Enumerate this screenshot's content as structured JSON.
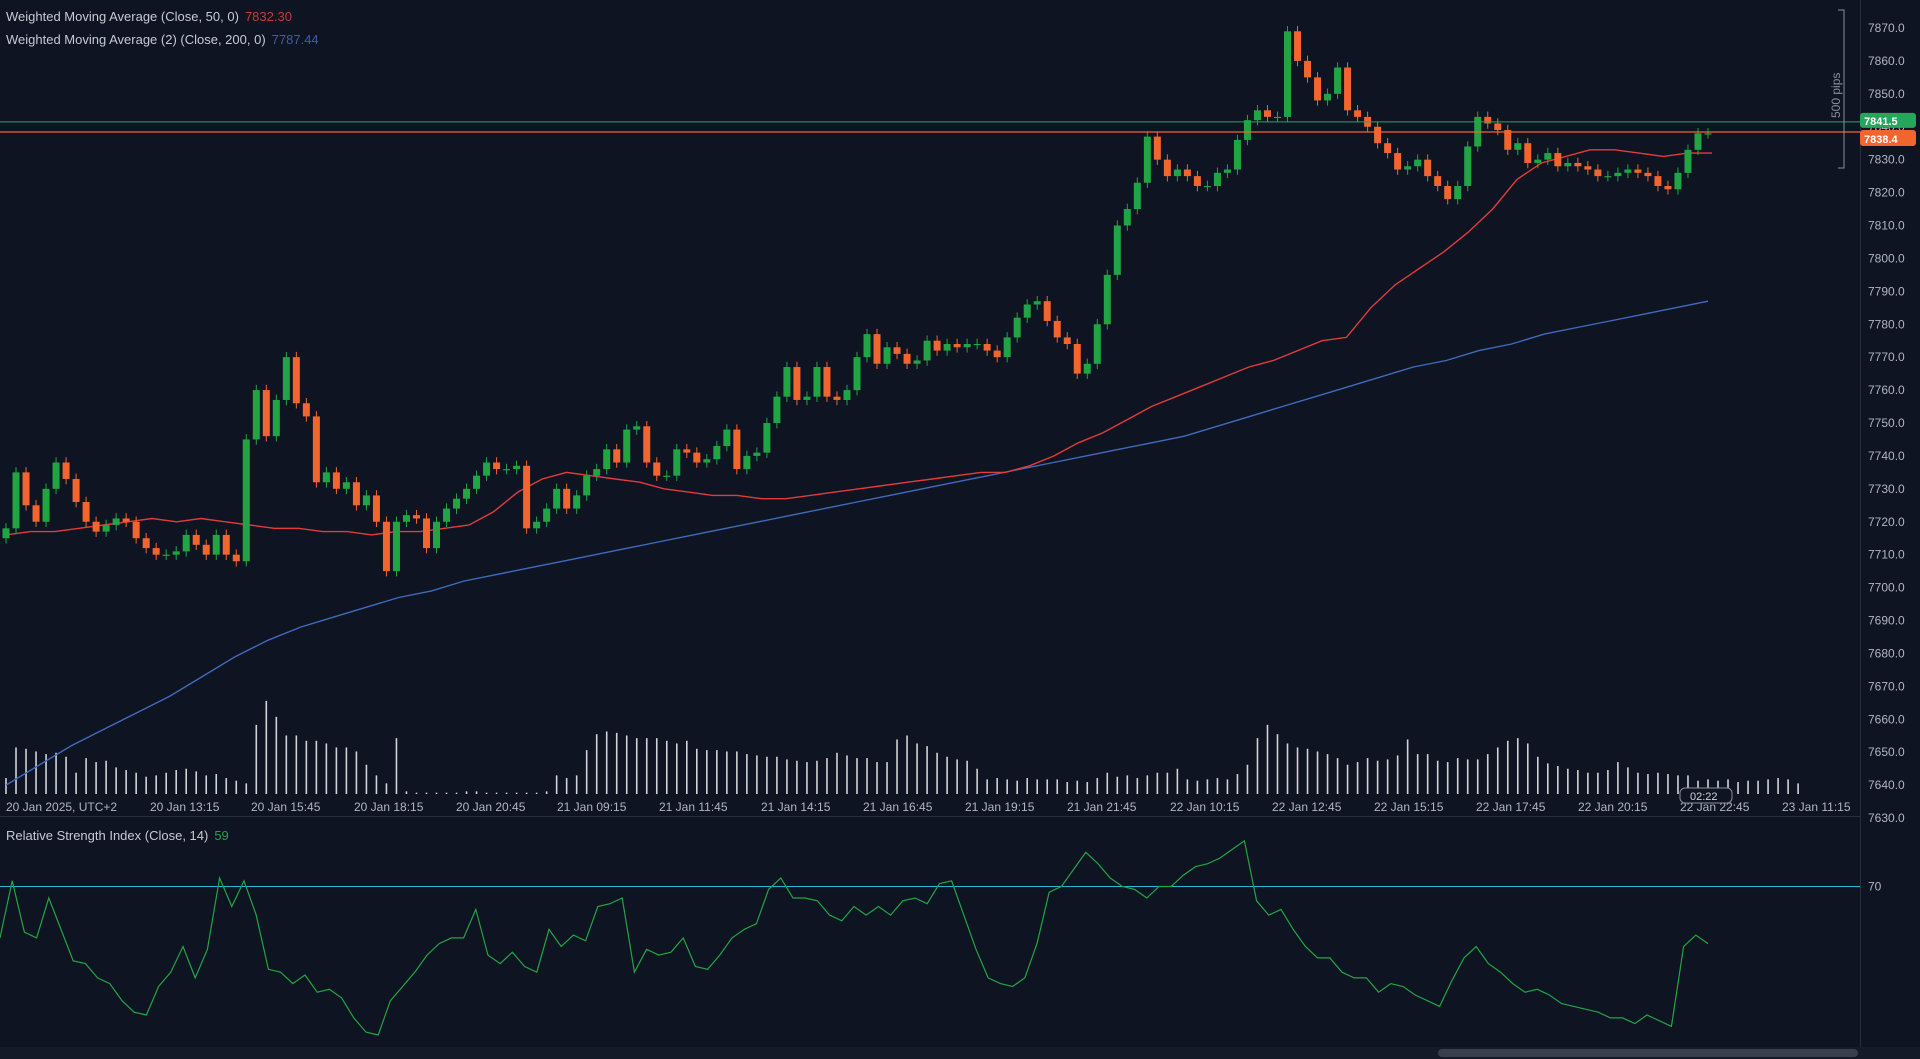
{
  "legend": {
    "wma50": {
      "label": "Weighted Moving Average (Close, 50, 0)",
      "value": "7832.30",
      "color": "#e33b3b"
    },
    "wma200": {
      "label": "Weighted Moving Average (2) (Close, 200, 0)",
      "value": "7787.44",
      "color": "#3f6bbd"
    }
  },
  "rsi": {
    "label": "Relative Strength Index (Close, 14)",
    "value": "59",
    "level_label": "70",
    "color": "#21a544",
    "level_color": "#28b7d8"
  },
  "price_axis": {
    "ticks": [
      "7870.0",
      "7860.0",
      "7850.0",
      "7840.0",
      "7830.0",
      "7820.0",
      "7810.0",
      "7800.0",
      "7790.0",
      "7780.0",
      "7770.0",
      "7760.0",
      "7750.0",
      "7740.0",
      "7730.0",
      "7720.0",
      "7710.0",
      "7700.0",
      "7690.0",
      "7680.0",
      "7670.0",
      "7660.0",
      "7650.0",
      "7640.0",
      "7630.0"
    ],
    "bid_label": "7841.5",
    "ask_label": "7838.4",
    "pips_label": "500 pips"
  },
  "time_axis": {
    "ticks": [
      "20 Jan 2025, UTC+2",
      "20 Jan 13:15",
      "20 Jan 15:45",
      "20 Jan 18:15",
      "20 Jan 20:45",
      "21 Jan 09:15",
      "21 Jan 11:45",
      "21 Jan 14:15",
      "21 Jan 16:45",
      "21 Jan 19:15",
      "21 Jan 21:45",
      "22 Jan 10:15",
      "22 Jan 12:45",
      "22 Jan 15:15",
      "22 Jan 17:45",
      "22 Jan 20:15",
      "22 Jan 22:45",
      "23 Jan 11:15"
    ],
    "countdown": "02:22"
  },
  "colors": {
    "up": "#21a544",
    "down": "#f2652f",
    "bid_line": "#25a56a",
    "ask_line": "#f2652f"
  },
  "chart_data": [
    {
      "type": "candlestick",
      "title": "",
      "ylim": [
        7630,
        7875
      ],
      "x_labels": [
        "20 Jan 2025, UTC+2",
        "20 Jan 13:15",
        "20 Jan 15:45",
        "20 Jan 18:15",
        "20 Jan 20:45",
        "21 Jan 09:15",
        "21 Jan 11:45",
        "21 Jan 14:15",
        "21 Jan 16:45",
        "21 Jan 19:15",
        "21 Jan 21:45",
        "22 Jan 10:15",
        "22 Jan 12:45",
        "22 Jan 15:15",
        "22 Jan 17:45",
        "22 Jan 20:15",
        "22 Jan 22:45",
        "23 Jan 11:15"
      ],
      "close": [
        7718,
        7735,
        7725,
        7720,
        7730,
        7738,
        7733,
        7726,
        7720,
        7717,
        7719,
        7721,
        7720,
        7715,
        7712,
        7710,
        7710,
        7711,
        7716,
        7713,
        7710,
        7716,
        7710,
        7708,
        7745,
        7760,
        7746,
        7757,
        7770,
        7756,
        7752,
        7732,
        7735,
        7730,
        7732,
        7725,
        7728,
        7720,
        7705,
        7720,
        7722,
        7721,
        7712,
        7720,
        7724,
        7727,
        7730,
        7734,
        7738,
        7736,
        7736,
        7737,
        7718,
        7720,
        7724,
        7730,
        7724,
        7728,
        7734,
        7736,
        7742,
        7738,
        7748,
        7749,
        7738,
        7734,
        7734,
        7742,
        7741,
        7738,
        7739,
        7743,
        7748,
        7736,
        7740,
        7741,
        7750,
        7758,
        7767,
        7757,
        7758,
        7767,
        7758,
        7757,
        7760,
        7770,
        7777,
        7768,
        7773,
        7771,
        7768,
        7769,
        7775,
        7772,
        7774,
        7773,
        7774,
        7774,
        7772,
        7770,
        7776,
        7782,
        7786,
        7787,
        7781,
        7776,
        7774,
        7765,
        7768,
        7780,
        7795,
        7810,
        7815,
        7823,
        7837,
        7830,
        7825,
        7827,
        7825,
        7822,
        7822,
        7826,
        7827,
        7836,
        7842,
        7845,
        7843,
        7843,
        7869,
        7860,
        7855,
        7848,
        7850,
        7858,
        7845,
        7843,
        7840,
        7835,
        7832,
        7827,
        7828,
        7830,
        7825,
        7822,
        7818,
        7822,
        7834,
        7843,
        7841,
        7839,
        7833,
        7835,
        7829,
        7830,
        7832,
        7828,
        7829,
        7828,
        7827,
        7825,
        7825,
        7826,
        7827,
        7826,
        7825,
        7822,
        7821,
        7826,
        7833,
        7838,
        7838
      ]
    },
    {
      "type": "line",
      "series": [
        {
          "name": "Weighted Moving Average (Close, 50, 0)",
          "values": [
            7716,
            7717,
            7717,
            7718,
            7719,
            7720,
            7721,
            7720,
            7721,
            7720,
            7719,
            7718,
            7718,
            7717,
            7717,
            7716,
            7717,
            7717,
            7718,
            7719,
            7723,
            7729,
            7733,
            7735,
            7734,
            7733,
            7732,
            7730,
            7729,
            7728,
            7728,
            7727,
            7727,
            7728,
            7729,
            7730,
            7731,
            7732,
            7733,
            7734,
            7735,
            7735,
            7737,
            7740,
            7744,
            7747,
            7751,
            7755,
            7758,
            7761,
            7764,
            7767,
            7769,
            7772,
            7775,
            7776,
            7785,
            7792,
            7797,
            7802,
            7808,
            7815,
            7824,
            7829,
            7831,
            7833,
            7833,
            7832,
            7831,
            7832,
            7832
          ]
        },
        {
          "name": "Weighted Moving Average (2) (Close, 200, 0)",
          "values": [
            7640,
            7646,
            7652,
            7657,
            7662,
            7667,
            7673,
            7679,
            7684,
            7688,
            7691,
            7694,
            7697,
            7699,
            7702,
            7704,
            7706,
            7708,
            7710,
            7712,
            7714,
            7716,
            7718,
            7720,
            7722,
            7724,
            7726,
            7728,
            7730,
            7732,
            7734,
            7736,
            7738,
            7740,
            7742,
            7744,
            7746,
            7749,
            7752,
            7755,
            7758,
            7761,
            7764,
            7767,
            7769,
            7772,
            7774,
            7777,
            7779,
            7781,
            7783,
            7785,
            7787
          ]
        }
      ],
      "ylim": [
        7630,
        7875
      ]
    },
    {
      "type": "bar",
      "name": "volume",
      "values": [
        12,
        35,
        34,
        32,
        30,
        31,
        28,
        16,
        27,
        24,
        25,
        20,
        18,
        16,
        13,
        14,
        16,
        18,
        19,
        17,
        14,
        15,
        12,
        10,
        8,
        52,
        70,
        58,
        44,
        44,
        40,
        40,
        38,
        35,
        35,
        32,
        22,
        14,
        8,
        42,
        2,
        1,
        1,
        1,
        1,
        1,
        2,
        2,
        1,
        1,
        1,
        1,
        1,
        1,
        2,
        14,
        12,
        14,
        33,
        45,
        47,
        46,
        44,
        42,
        42,
        42,
        40,
        38,
        40,
        34,
        33,
        33,
        32,
        32,
        30,
        29,
        28,
        28,
        26,
        25,
        24,
        25,
        27,
        31,
        29,
        27,
        27,
        24,
        24,
        41,
        44,
        38,
        36,
        31,
        28,
        26,
        25,
        19,
        11,
        12,
        11,
        10,
        12,
        11,
        11,
        11,
        9,
        10,
        9,
        12,
        16,
        13,
        14,
        12,
        14,
        16,
        16,
        19,
        11,
        10,
        11,
        12,
        11,
        15,
        22,
        42,
        52,
        45,
        38,
        35,
        34,
        32,
        30,
        27,
        22,
        24,
        27,
        25,
        26,
        29,
        41,
        30,
        30,
        25,
        24,
        27,
        26,
        26,
        30,
        35,
        40,
        42,
        38,
        28,
        23,
        21,
        19,
        18,
        16,
        16,
        18,
        24,
        20,
        16,
        15,
        16,
        15,
        14,
        14,
        10,
        11,
        10,
        11,
        9,
        10,
        10,
        11,
        12,
        11,
        8
      ]
    },
    {
      "type": "line",
      "name": "Relative Strength Index (Close, 14)",
      "values": [
        52,
        72,
        54,
        52,
        66,
        55,
        44,
        43,
        38,
        36,
        30,
        26,
        25,
        35,
        40,
        49,
        38,
        48,
        73,
        63,
        72,
        60,
        41,
        40,
        36,
        39,
        33,
        34,
        31,
        24,
        19,
        18,
        30,
        35,
        40,
        46,
        50,
        52,
        52,
        62,
        46,
        43,
        47,
        42,
        40,
        55,
        49,
        53,
        51,
        63,
        64,
        66,
        40,
        48,
        46,
        47,
        52,
        42,
        41,
        46,
        52,
        55,
        57,
        69,
        73,
        66,
        66,
        65,
        60,
        58,
        63,
        60,
        63,
        60,
        65,
        66,
        64,
        71,
        72,
        60,
        48,
        38,
        36,
        35,
        38,
        50,
        68,
        70,
        76,
        82,
        78,
        73,
        70,
        69,
        66,
        70,
        70,
        74,
        77,
        78,
        80,
        83,
        86,
        65,
        60,
        62,
        55,
        49,
        45,
        45,
        40,
        38,
        38,
        33,
        36,
        35,
        32,
        30,
        28,
        37,
        45,
        49,
        43,
        40,
        36,
        33,
        34,
        32,
        29,
        28,
        27,
        26,
        24,
        24,
        22,
        25,
        23,
        21,
        49,
        53,
        50
      ],
      "level": 70,
      "current": 59
    }
  ]
}
